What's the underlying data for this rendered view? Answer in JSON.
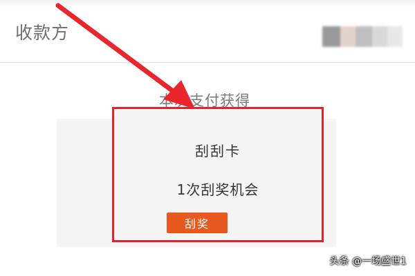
{
  "payee": {
    "label": "收款方",
    "value_swatches": [
      "#9a9a9a",
      "#e2d3cb",
      "#bfbfbf",
      "#d9d9d9",
      "#e8e8e8"
    ]
  },
  "reward": {
    "heading": "本次支付获得",
    "card_title": "刮刮卡",
    "card_subtitle": "1次刮奖机会",
    "button_label": "刮奖"
  },
  "watermark": "头条 @一场盛世1",
  "colors": {
    "highlight": "#e0242b",
    "arrow": "#e8262c",
    "button": "#e8591f"
  }
}
